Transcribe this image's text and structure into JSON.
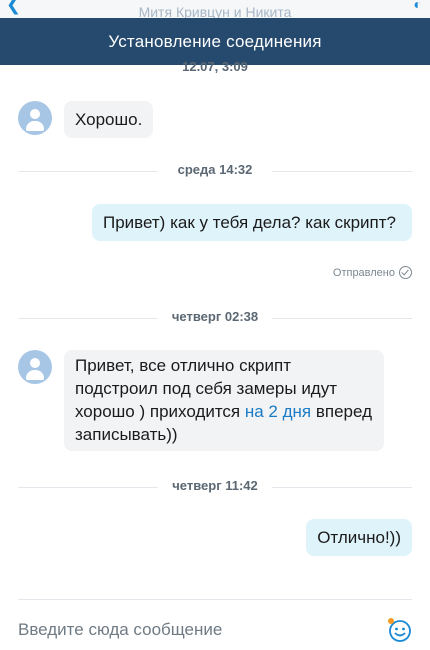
{
  "header": {
    "ghost_title": "Митя Кривцун и Никита",
    "status_banner": "Установление соединения"
  },
  "chat": {
    "top_partial_time": "12.07, 3:09",
    "msg1": "Хорошо.",
    "sep1": "среда 14:32",
    "msg2": "Привет) как у тебя дела? как скрипт?",
    "sent_status": "Отправлено",
    "sep2": "четверг 02:38",
    "msg3_part1": "Привет, все отлично скрипт подстроил под себя замеры идут хорошо ) приходится ",
    "msg3_link": "на 2 дня",
    "msg3_part2": " вперед записывать))",
    "sep3": "четверг 11:42",
    "msg4": "Отлично!))"
  },
  "composer": {
    "placeholder": "Введите сюда сообщение"
  },
  "colors": {
    "banner": "#264a6e",
    "accent": "#1a8ad4",
    "bubble_in": "#f1f3f5",
    "bubble_out": "#dff3fb"
  },
  "icons": {
    "back": "back-arrow-icon",
    "call": "call-icon",
    "avatar": "user-avatar-icon",
    "sent": "check-circle-icon",
    "emoji": "emoji-icon"
  }
}
